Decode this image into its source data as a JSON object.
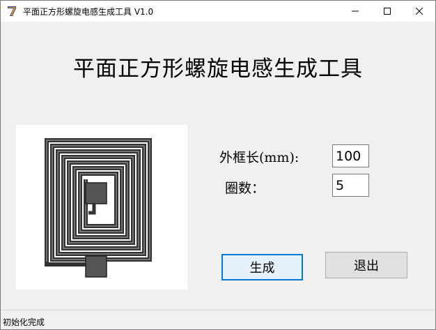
{
  "window": {
    "title": "平面正方形螺旋电感生成工具 V1.0",
    "icon": "app-logo-icon",
    "controls": [
      "minimize-icon",
      "maximize-icon",
      "close-icon"
    ]
  },
  "main": {
    "heading": "平面正方形螺旋电感生成工具",
    "preview": {
      "icon": "spiral-inductor-preview"
    },
    "outer_length": {
      "label": "外框长(mm):",
      "value": "100"
    },
    "turns": {
      "label": "圈数：",
      "value": "5"
    },
    "generate_button": "生成",
    "exit_button": "退出"
  },
  "status": {
    "text": "初始化完成"
  },
  "colors": {
    "accent": "#0078d7",
    "background": "#f0f0f0"
  }
}
